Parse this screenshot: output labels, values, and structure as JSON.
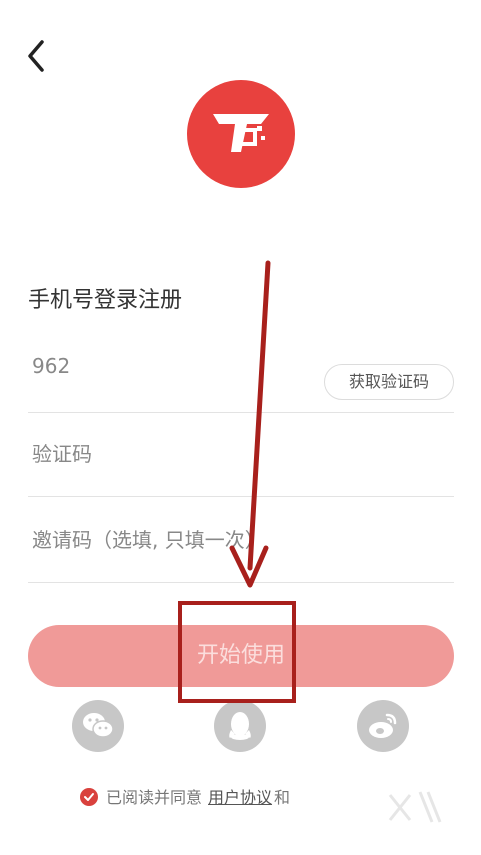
{
  "header": {
    "back_icon": "chevron-left-icon"
  },
  "logo": {
    "icon": "app-logo-icon",
    "color": "#e8413e"
  },
  "form": {
    "title": "手机号登录注册",
    "phone_value": "962",
    "get_code_label": "获取验证码",
    "code_placeholder": "验证码",
    "invite_placeholder": "邀请码（选填, 只填一次）"
  },
  "start_button_label": "开始使用",
  "social": {
    "icons": [
      "wechat-icon",
      "qq-icon",
      "weibo-icon"
    ]
  },
  "agreement": {
    "checked": true,
    "prefix": "已阅读并同意",
    "link_user": "用户协议",
    "joiner": "和"
  },
  "colors": {
    "accent": "#e8413e",
    "button_bg": "#f09a98",
    "annotation": "#a8201c"
  }
}
